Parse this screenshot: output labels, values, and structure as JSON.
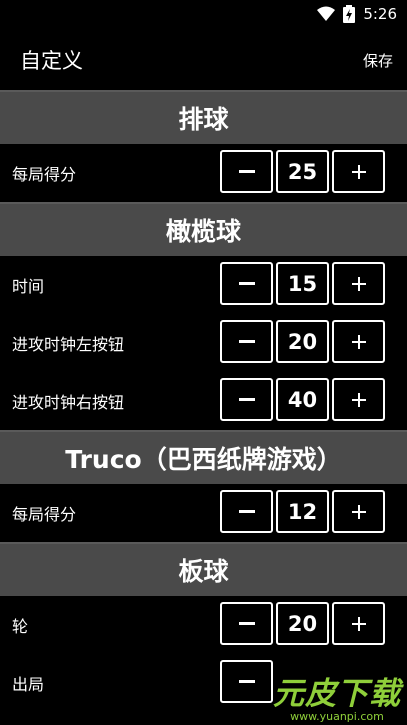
{
  "status_bar": {
    "time": "5:26"
  },
  "appbar": {
    "title": "自定义",
    "action": "保存"
  },
  "sections": [
    {
      "title": "排球",
      "rows": [
        {
          "label": "每局得分",
          "value": "25"
        }
      ]
    },
    {
      "title": "橄榄球",
      "rows": [
        {
          "label": "时间",
          "value": "15"
        },
        {
          "label": "进攻时钟左按钮",
          "value": "20"
        },
        {
          "label": "进攻时钟右按钮",
          "value": "40"
        }
      ]
    },
    {
      "title": "Truco（巴西纸牌游戏）",
      "rows": [
        {
          "label": "每局得分",
          "value": "12"
        }
      ]
    },
    {
      "title": "板球",
      "rows": [
        {
          "label": "轮",
          "value": "20"
        },
        {
          "label": "出局",
          "value": ""
        }
      ]
    }
  ],
  "watermark": {
    "logo": "元皮下载",
    "url": "www.yuanpi.com"
  }
}
